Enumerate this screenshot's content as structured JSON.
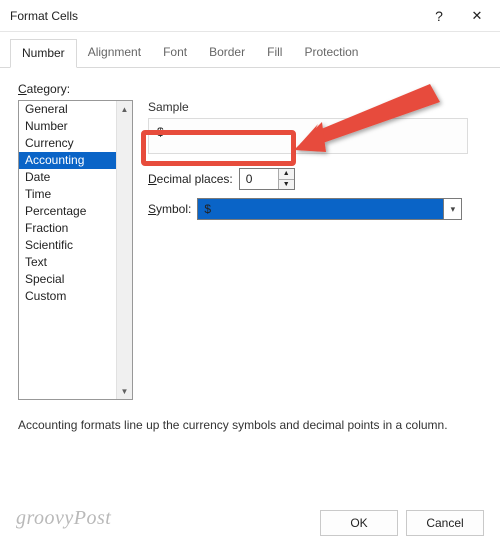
{
  "window": {
    "title": "Format Cells",
    "help_glyph": "?",
    "close_glyph": "✕"
  },
  "tabs": {
    "items": [
      "Number",
      "Alignment",
      "Font",
      "Border",
      "Fill",
      "Protection"
    ],
    "active_index": 0
  },
  "category": {
    "label": "Category:",
    "items": [
      "General",
      "Number",
      "Currency",
      "Accounting",
      "Date",
      "Time",
      "Percentage",
      "Fraction",
      "Scientific",
      "Text",
      "Special",
      "Custom"
    ],
    "selected_index": 3
  },
  "sample": {
    "label": "Sample",
    "value": "$-"
  },
  "decimal": {
    "label": "Decimal places:",
    "value": "0"
  },
  "symbol": {
    "label": "Symbol:",
    "value": "$"
  },
  "description": "Accounting formats line up the currency symbols and decimal points in a column.",
  "buttons": {
    "ok": "OK",
    "cancel": "Cancel"
  },
  "watermark": "groovyPost",
  "annotation": {
    "highlight": "decimal-places-row",
    "arrow_color": "#e74c3c"
  }
}
